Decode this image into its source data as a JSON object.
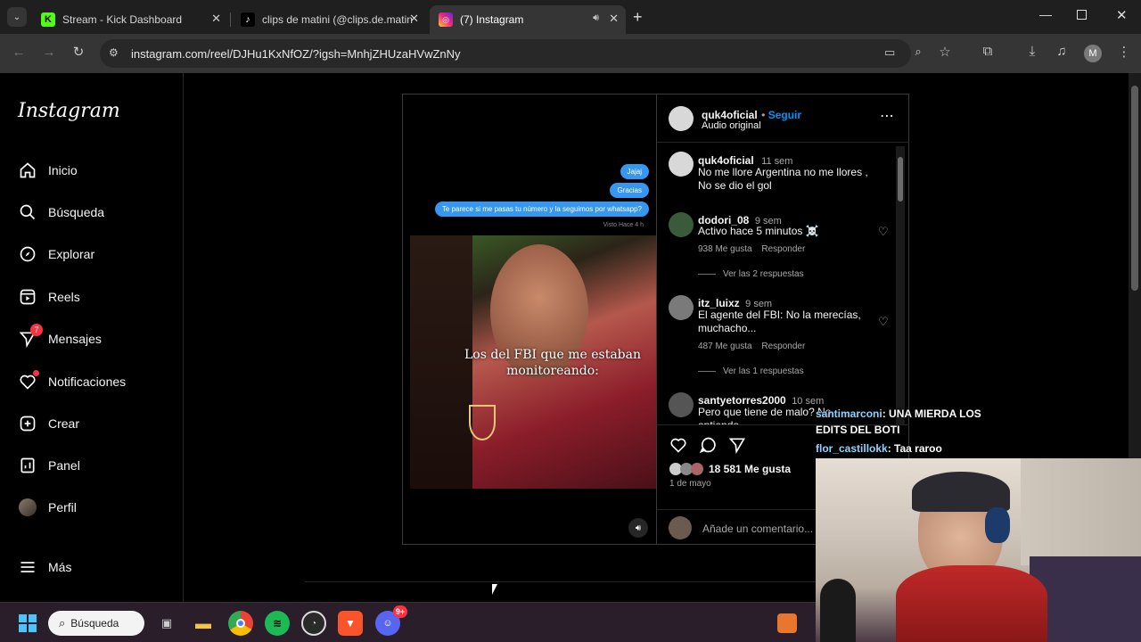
{
  "browser": {
    "tabs": [
      {
        "title": "Stream - Kick Dashboard",
        "icon": "kick-icon",
        "active": false
      },
      {
        "title": "clips de matini (@clips.de.matin",
        "icon": "tiktok-icon",
        "active": false
      },
      {
        "title": "(7) Instagram",
        "icon": "instagram-icon",
        "active": true
      }
    ],
    "url": "instagram.com/reel/DJHu1KxNfOZ/?igsh=MnhjZHUzaHVwZnNy",
    "profile_initial": "M"
  },
  "sidebar": {
    "logo": "Instagram",
    "items": [
      {
        "label": "Inicio",
        "icon": "home-icon"
      },
      {
        "label": "Búsqueda",
        "icon": "search-icon"
      },
      {
        "label": "Explorar",
        "icon": "compass-icon"
      },
      {
        "label": "Reels",
        "icon": "reels-icon"
      },
      {
        "label": "Mensajes",
        "icon": "messages-icon",
        "badge": "7"
      },
      {
        "label": "Notificaciones",
        "icon": "heart-icon"
      },
      {
        "label": "Crear",
        "icon": "plus-icon"
      },
      {
        "label": "Panel",
        "icon": "dashboard-icon"
      },
      {
        "label": "Perfil",
        "icon": "avatar-icon"
      },
      {
        "label": "Más",
        "icon": "menu-icon"
      }
    ]
  },
  "video": {
    "bubbles": [
      "Jajaj",
      "Gracias",
      "Te parece si me pasas tu número y la seguimos por whatsapp?"
    ],
    "seen": "Visto Hace 4 h",
    "caption": "Los del FBI que me estaban monitoreando:"
  },
  "post": {
    "author": "quk4oficial",
    "follow": "Seguir",
    "audio": "Audio original",
    "comments": [
      {
        "user": "quk4oficial",
        "time": "11 sem",
        "text": "No me llore Argentina no me llores , No se dio el gol"
      },
      {
        "user": "dodori_08",
        "time": "9 sem",
        "text": "Activo hace 5 minutos ☠️",
        "likes": "938 Me gusta",
        "reply": "Responder",
        "replies": "Ver las 2 respuestas"
      },
      {
        "user": "itz_luixz",
        "time": "9 sem",
        "text": "El agente del FBI: No la merecías, muchacho...",
        "likes": "487 Me gusta",
        "reply": "Responder",
        "replies": "Ver las 1 respuestas"
      },
      {
        "user": "santyetorres2000",
        "time": "10 sem",
        "text": "Pero que tiene de malo? No entiendo"
      }
    ],
    "likes": "18 581 Me gusta",
    "date": "1 de mayo",
    "add_comment_placeholder": "Añade un comentario..."
  },
  "stream_chat": [
    {
      "user": "santimarconi",
      "text": ": UNA MIERDA LOS EDITS DEL BOTI"
    },
    {
      "user": "flor_castillokk",
      "text": ": Taa raroo"
    }
  ],
  "taskbar": {
    "search_label": "Búsqueda",
    "apps": [
      "windows-icon",
      "task-view-icon",
      "file-explorer-icon",
      "chrome-icon",
      "spotify-icon",
      "obs-icon",
      "brave-icon",
      "discord-icon"
    ],
    "discord_badge": "9+"
  }
}
